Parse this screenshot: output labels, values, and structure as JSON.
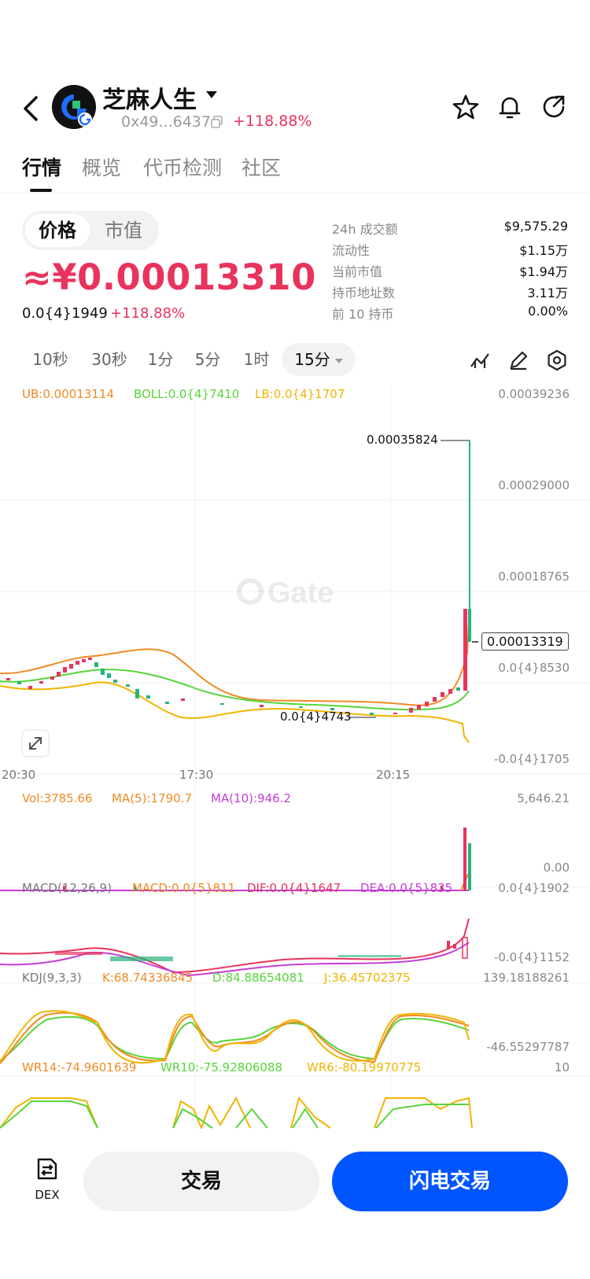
{
  "header": {
    "title": "芝麻人生",
    "address": "0x49...6437",
    "change": "+118.88%"
  },
  "tabs": [
    "行情",
    "概览",
    "代币检测",
    "社区"
  ],
  "price": {
    "toggle_price": "价格",
    "toggle_mcap": "市值",
    "main": "≈¥0.00013310",
    "usd": "0.0{4}1949",
    "change": "+118.88%"
  },
  "stats": [
    {
      "label": "24h 成交额",
      "value": "$9,575.29"
    },
    {
      "label": "流动性",
      "value": "$1.15万"
    },
    {
      "label": "当前市值",
      "value": "$1.94万"
    },
    {
      "label": "持币地址数",
      "value": "3.11万"
    },
    {
      "label": "前 10 持币",
      "value": "0.00%"
    }
  ],
  "intervals": [
    "10秒",
    "30秒",
    "1分",
    "5分",
    "1时",
    "15分"
  ],
  "main_chart": {
    "ub": "UB:0.00013114",
    "boll": "BOLL:0.0{4}7410",
    "lb": "LB:0.0{4}1707",
    "y_labels": [
      "0.00039236",
      "0.00029000",
      "0.00018765",
      "0.0{4}8530",
      "-0.0{4}1705"
    ],
    "high_label": "0.00035824",
    "low_label": "0.0{4}4743",
    "current_label": "0.00013319",
    "time_labels": [
      "20:30",
      "17:30",
      "20:15"
    ],
    "watermark": "Gate"
  },
  "vol_chart": {
    "vol": "Vol:3785.66",
    "ma5": "MA(5):1790.7",
    "ma10": "MA(10):946.2",
    "y_top": "5,646.21",
    "y_bottom": "0.00"
  },
  "macd_chart": {
    "title": "MACD(12,26,9)",
    "macd": "MACD:0.0{5}811",
    "dif": "DIF:0.0{4}1647",
    "dea": "DEA:0.0{5}835",
    "y_top": "0.0{4}1902",
    "y_bottom": "-0.0{4}1152"
  },
  "kdj_chart": {
    "title": "KDJ(9,3,3)",
    "k": "K:68.74336845",
    "d": "D:84.88654081",
    "j": "J:36.45702375",
    "y_top": "139.18188261",
    "y_bottom": "-46.55297787"
  },
  "wr_chart": {
    "wr14": "WR14:-74.9601639",
    "wr10": "WR10:-75.92806088",
    "wr6": "WR6:-80.19970775",
    "y_top": "10"
  },
  "bottom": {
    "dex_label": "DEX",
    "trade": "交易",
    "flash_trade": "闪电交易"
  },
  "colors": {
    "up": "#e8335d",
    "down": "#26b47a",
    "accent": "#0055ff",
    "ub": "#f08a24",
    "boll": "#57d43a",
    "lb": "#f0b400",
    "ma10": "#c43fd6"
  }
}
